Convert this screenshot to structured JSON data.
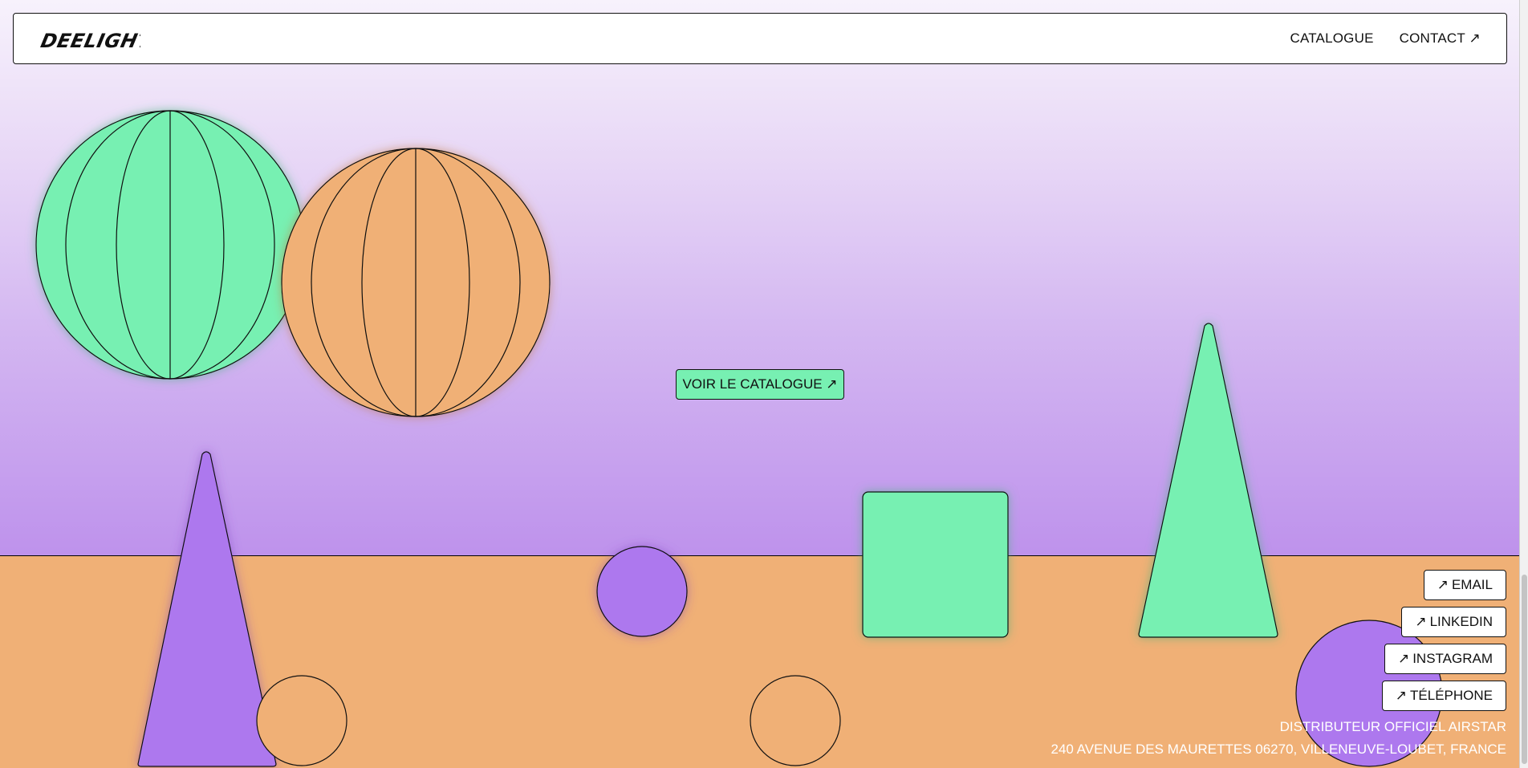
{
  "header": {
    "logo_text": "DEELIGHT",
    "nav": [
      {
        "label": "CATALOGUE"
      },
      {
        "label": "CONTACT ↗"
      }
    ]
  },
  "hero": {
    "cta_label": "VOIR LE CATALOGUE ↗"
  },
  "contact_links": [
    {
      "label": "EMAIL"
    },
    {
      "label": "LINKEDIN"
    },
    {
      "label": "INSTAGRAM"
    },
    {
      "label": "TÉLÉPHONE"
    }
  ],
  "link_arrow": "↗",
  "footer": {
    "line1": "DISTRIBUTEUR OFFICIEL AIRSTAR",
    "line2": "240 AVENUE DES MAURETTES 06270, VILLENEUVE-LOUBET, FRANCE"
  },
  "colors": {
    "mint": "#77f0b2",
    "orange": "#f0b076",
    "purple": "#ad78ee",
    "ink": "#111111"
  }
}
